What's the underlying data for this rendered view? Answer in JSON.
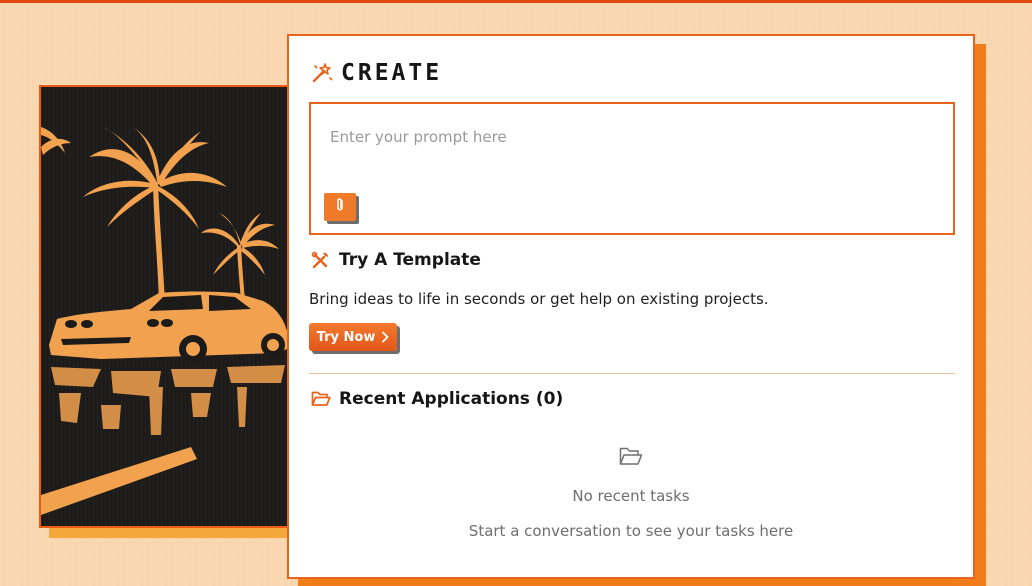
{
  "create": {
    "title": "CREATE",
    "prompt_placeholder": "Enter your prompt here",
    "prompt_value": "",
    "attach_icon": "paperclip-icon"
  },
  "template": {
    "title": "Try A Template",
    "description": "Bring ideas to life in seconds or get help on existing projects.",
    "button_label": "Try Now",
    "icon": "tools-icon"
  },
  "recent": {
    "title": "Recent Applications (0)",
    "icon": "folder-icon",
    "empty_title": "No recent tasks",
    "empty_subtitle": "Start a conversation to see your tasks here"
  },
  "colors": {
    "accent": "#e8641c",
    "background": "#f9d6ad",
    "image_tint": "#f2a24e",
    "image_dark": "#1d1b1a"
  }
}
